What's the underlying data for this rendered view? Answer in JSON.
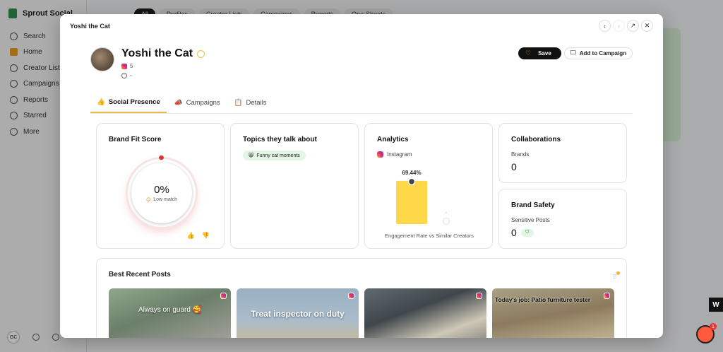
{
  "background": {
    "brand": "Sprout Social",
    "nav": [
      "Search",
      "Home",
      "Creator Lists",
      "Campaigns",
      "Reports",
      "Starred",
      "More"
    ],
    "active_nav": "Home",
    "tabs": [
      "All",
      "Profiles",
      "Creator Lists",
      "Campaigns",
      "Reports",
      "One-Sheets"
    ],
    "user_initials": "GC",
    "w_badge": "W",
    "chat_badge_count": "1"
  },
  "modal": {
    "title": "Yoshi the Cat",
    "controls": {
      "prev_icon": "‹",
      "next_icon": "›",
      "open_icon": "↗",
      "close_icon": "✕"
    }
  },
  "profile": {
    "name": "Yoshi the Cat",
    "ig_count": "5",
    "followers": "-",
    "save_label": "Save",
    "add_label": "Add to Campaign"
  },
  "tabs": [
    {
      "label": "Social Presence",
      "icon": "👍",
      "active": true
    },
    {
      "label": "Campaigns",
      "icon": "📣",
      "active": false
    },
    {
      "label": "Details",
      "icon": "📋",
      "active": false
    }
  ],
  "brand_fit": {
    "title": "Brand Fit Score",
    "score": "0%",
    "label": "Low match",
    "emoji": "😐"
  },
  "topics": {
    "title": "Topics they talk about",
    "chips": [
      {
        "emoji": "😸",
        "label": "Funny cat moments"
      }
    ]
  },
  "analytics": {
    "title": "Analytics",
    "platform": "Instagram",
    "caption": "Engagement Rate vs Similar Creators"
  },
  "chart_data": {
    "type": "bar",
    "title": "",
    "xlabel": "Engagement Rate vs Similar Creators",
    "categories": [
      "",
      ""
    ],
    "values": [
      69.44,
      0
    ],
    "value_labels": [
      "69.44%",
      "-"
    ],
    "ylim": [
      0,
      100
    ],
    "colors": [
      "#ffd84a",
      "#ffd84a"
    ]
  },
  "collaborations": {
    "title": "Collaborations",
    "label": "Brands",
    "value": "0"
  },
  "brand_safety": {
    "title": "Brand Safety",
    "label": "Sensitive Posts",
    "value": "0"
  },
  "posts": {
    "title": "Best Recent Posts",
    "items": [
      {
        "caption": "Always on guard 🥰"
      },
      {
        "caption": "Treat inspector on duty"
      },
      {
        "caption": ""
      },
      {
        "caption": "Today's job: Patio furniture tester"
      }
    ]
  }
}
